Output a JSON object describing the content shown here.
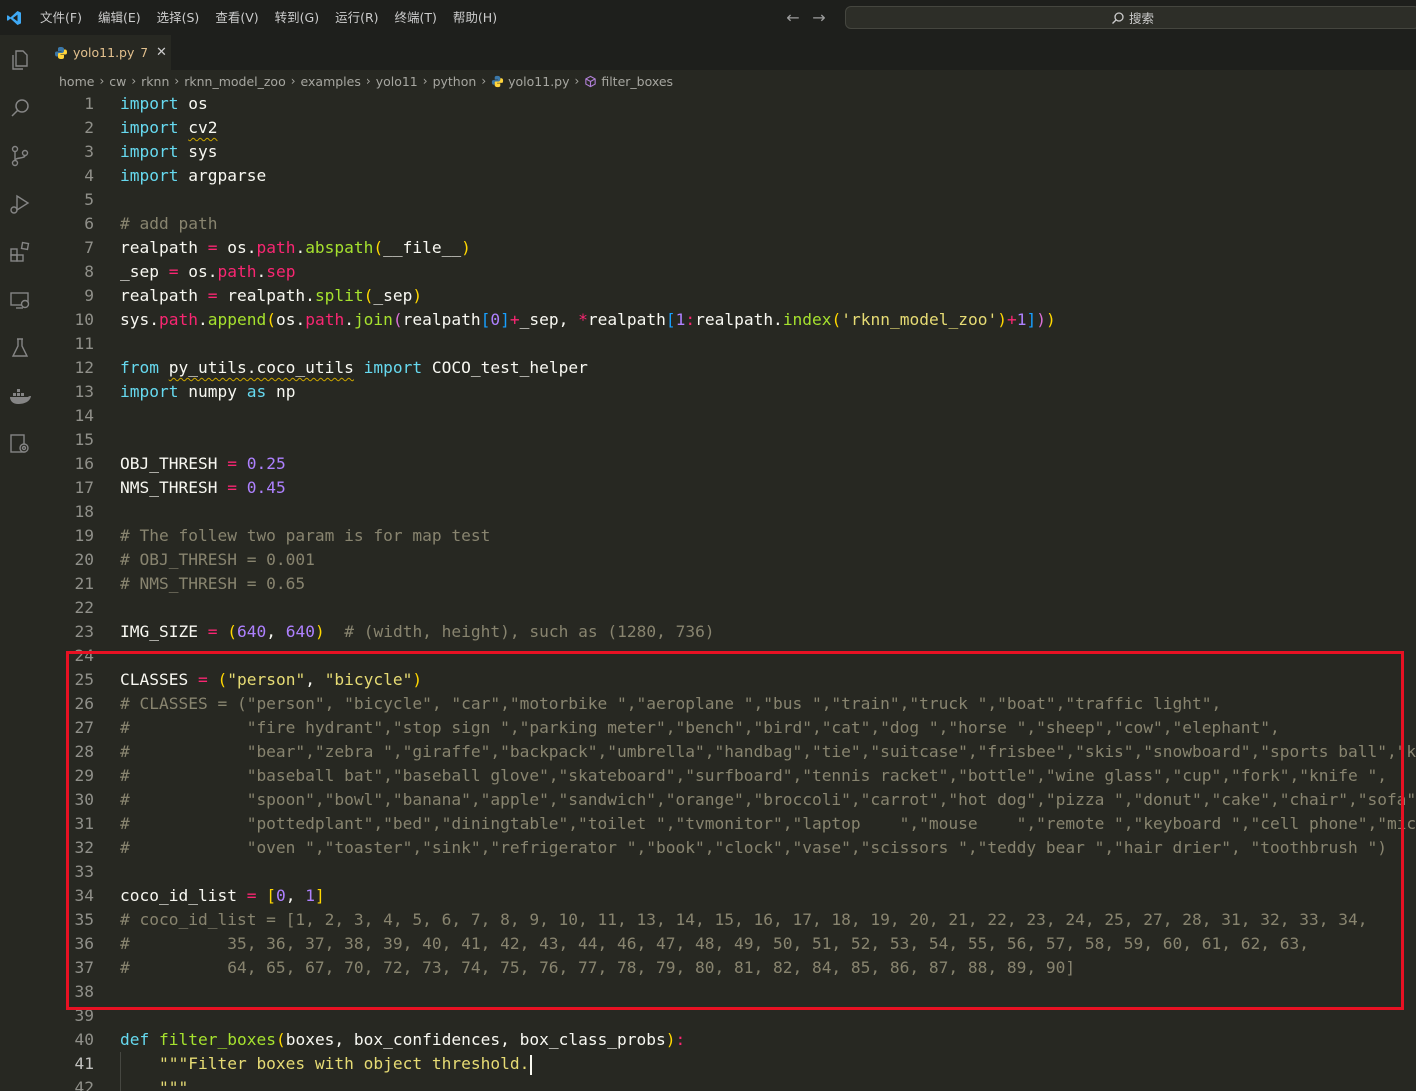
{
  "menu": [
    "文件(F)",
    "编辑(E)",
    "选择(S)",
    "查看(V)",
    "转到(G)",
    "运行(R)",
    "终端(T)",
    "帮助(H)"
  ],
  "search": {
    "label": "搜索"
  },
  "activity_icons": [
    "explorer-icon",
    "search-icon",
    "source-control-icon",
    "run-debug-icon",
    "extensions-icon",
    "remote-explorer-icon",
    "testing-icon",
    "docker-icon",
    "settings-sync-icon"
  ],
  "tab": {
    "name": "yolo11.py",
    "badge": "7",
    "close": "✕"
  },
  "breadcrumb": [
    "home",
    "cw",
    "rknn",
    "rknn_model_zoo",
    "examples",
    "yolo11",
    "python",
    "yolo11.py",
    "filter_boxes"
  ],
  "editor": {
    "active_line": 41,
    "lines": [
      {
        "n": "1",
        "text": "import os"
      },
      {
        "n": "2",
        "text": "import cv2"
      },
      {
        "n": "3",
        "text": "import sys"
      },
      {
        "n": "4",
        "text": "import argparse"
      },
      {
        "n": "5",
        "text": ""
      },
      {
        "n": "6",
        "text": "# add path"
      },
      {
        "n": "7",
        "text": "realpath = os.path.abspath(__file__)"
      },
      {
        "n": "8",
        "text": "_sep = os.path.sep"
      },
      {
        "n": "9",
        "text": "realpath = realpath.split(_sep)"
      },
      {
        "n": "10",
        "text": "sys.path.append(os.path.join(realpath[0]+_sep, *realpath[1:realpath.index('rknn_model_zoo')+1]))"
      },
      {
        "n": "11",
        "text": ""
      },
      {
        "n": "12",
        "text": "from py_utils.coco_utils import COCO_test_helper"
      },
      {
        "n": "13",
        "text": "import numpy as np"
      },
      {
        "n": "14",
        "text": ""
      },
      {
        "n": "15",
        "text": ""
      },
      {
        "n": "16",
        "text": "OBJ_THRESH = 0.25"
      },
      {
        "n": "17",
        "text": "NMS_THRESH = 0.45"
      },
      {
        "n": "18",
        "text": ""
      },
      {
        "n": "19",
        "text": "# The follew two param is for map test"
      },
      {
        "n": "20",
        "text": "# OBJ_THRESH = 0.001"
      },
      {
        "n": "21",
        "text": "# NMS_THRESH = 0.65"
      },
      {
        "n": "22",
        "text": ""
      },
      {
        "n": "23",
        "text": "IMG_SIZE = (640, 640)  # (width, height), such as (1280, 736)"
      },
      {
        "n": "24",
        "text": ""
      },
      {
        "n": "25",
        "text": "CLASSES = (\"person\", \"bicycle\")"
      },
      {
        "n": "26",
        "text": "# CLASSES = (\"person\", \"bicycle\", \"car\",\"motorbike \",\"aeroplane \",\"bus \",\"train\",\"truck \",\"boat\",\"traffic light\","
      },
      {
        "n": "27",
        "text": "#            \"fire hydrant\",\"stop sign \",\"parking meter\",\"bench\",\"bird\",\"cat\",\"dog \",\"horse \",\"sheep\",\"cow\",\"elephant\","
      },
      {
        "n": "28",
        "text": "#            \"bear\",\"zebra \",\"giraffe\",\"backpack\",\"umbrella\",\"handbag\",\"tie\",\"suitcase\",\"frisbee\",\"skis\",\"snowboard\",\"sports ball\",\"kite\","
      },
      {
        "n": "29",
        "text": "#            \"baseball bat\",\"baseball glove\",\"skateboard\",\"surfboard\",\"tennis racket\",\"bottle\",\"wine glass\",\"cup\",\"fork\",\"knife \","
      },
      {
        "n": "30",
        "text": "#            \"spoon\",\"bowl\",\"banana\",\"apple\",\"sandwich\",\"orange\",\"broccoli\",\"carrot\",\"hot dog\",\"pizza \",\"donut\",\"cake\",\"chair\",\"sofa\","
      },
      {
        "n": "31",
        "text": "#            \"pottedplant\",\"bed\",\"diningtable\",\"toilet \",\"tvmonitor\",\"laptop    \",\"mouse    \",\"remote \",\"keyboard \",\"cell phone\",\"microwave \","
      },
      {
        "n": "32",
        "text": "#            \"oven \",\"toaster\",\"sink\",\"refrigerator \",\"book\",\"clock\",\"vase\",\"scissors \",\"teddy bear \",\"hair drier\", \"toothbrush \")"
      },
      {
        "n": "33",
        "text": ""
      },
      {
        "n": "34",
        "text": "coco_id_list = [0, 1]"
      },
      {
        "n": "35",
        "text": "# coco_id_list = [1, 2, 3, 4, 5, 6, 7, 8, 9, 10, 11, 13, 14, 15, 16, 17, 18, 19, 20, 21, 22, 23, 24, 25, 27, 28, 31, 32, 33, 34,"
      },
      {
        "n": "36",
        "text": "#          35, 36, 37, 38, 39, 40, 41, 42, 43, 44, 46, 47, 48, 49, 50, 51, 52, 53, 54, 55, 56, 57, 58, 59, 60, 61, 62, 63,"
      },
      {
        "n": "37",
        "text": "#          64, 65, 67, 70, 72, 73, 74, 75, 76, 77, 78, 79, 80, 81, 82, 84, 85, 86, 87, 88, 89, 90]"
      },
      {
        "n": "38",
        "text": ""
      },
      {
        "n": "39",
        "text": ""
      },
      {
        "n": "40",
        "text": "def filter_boxes(boxes, box_confidences, box_class_probs):"
      },
      {
        "n": "41",
        "text": "    \"\"\"Filter boxes with object threshold."
      },
      {
        "n": "42",
        "text": "    \"\"\""
      }
    ]
  },
  "colors": {
    "background": "#272822",
    "highlight_box": "#e81123",
    "keyword": "#66d9ef",
    "operator": "#f92672",
    "string": "#e6db74",
    "number": "#ae81ff",
    "comment": "#88846f",
    "function": "#a6e22e"
  }
}
